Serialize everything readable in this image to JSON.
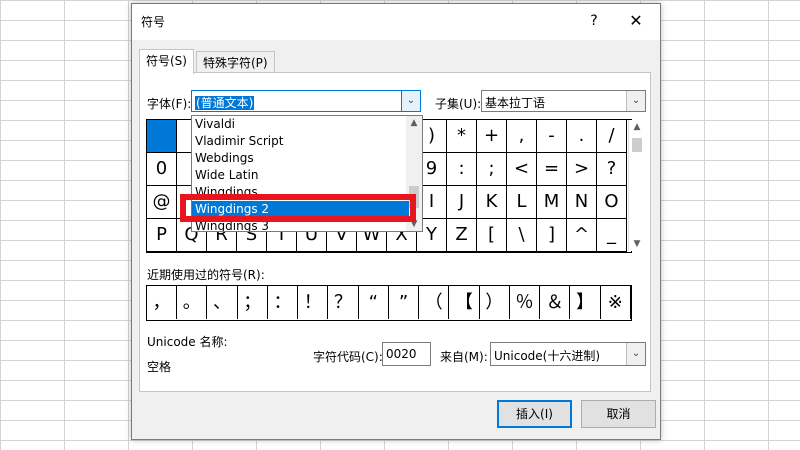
{
  "dialog": {
    "title": "符号",
    "help_label": "?",
    "close_label": "✕"
  },
  "tabs": [
    {
      "label": "符号(S)"
    },
    {
      "label": "特殊字符(P)"
    }
  ],
  "font": {
    "label": "字体(F):",
    "value": "(普通文本)",
    "options": [
      "Vivaldi",
      "Vladimir Script",
      "Webdings",
      "Wide Latin",
      "Wingdings",
      "Wingdings 2",
      "Wingdings 3"
    ],
    "selected": "Wingdings 2"
  },
  "subset": {
    "label": "子集(U):",
    "value": "基本拉丁语"
  },
  "grid": {
    "rows": [
      [
        " ",
        "",
        "",
        "",
        "",
        "",
        "",
        "",
        "",
        ")",
        "*",
        "+",
        ",",
        "-",
        ".",
        "/"
      ],
      [
        "0",
        "",
        "",
        "",
        "",
        "",
        "",
        "",
        "",
        "9",
        ":",
        ";",
        "<",
        "=",
        ">",
        "?"
      ],
      [
        "@",
        "",
        "",
        "",
        "",
        "",
        "",
        "",
        "",
        "I",
        "J",
        "K",
        "L",
        "M",
        "N",
        "O"
      ],
      [
        "P",
        "Q",
        "R",
        "S",
        "T",
        "U",
        "V",
        "W",
        "X",
        "Y",
        "Z",
        "[",
        "\\",
        "]",
        "^",
        "_"
      ]
    ]
  },
  "recent": {
    "label": "近期使用过的符号(R):",
    "symbols": [
      "，",
      "。",
      "、",
      "；",
      "：",
      "！",
      "？",
      "“",
      "”",
      "（",
      "【",
      "）",
      "％",
      "＆",
      "】",
      "※"
    ]
  },
  "unicode": {
    "name_label": "Unicode 名称:",
    "name_value": "空格",
    "code_label": "字符代码(C):",
    "code_value": "0020",
    "from_label": "来自(M):",
    "from_value": "Unicode(十六进制)"
  },
  "buttons": {
    "insert": "插入(I)",
    "cancel": "取消"
  },
  "colors": {
    "accent": "#0078d7",
    "highlight_box": "#e8141e"
  }
}
